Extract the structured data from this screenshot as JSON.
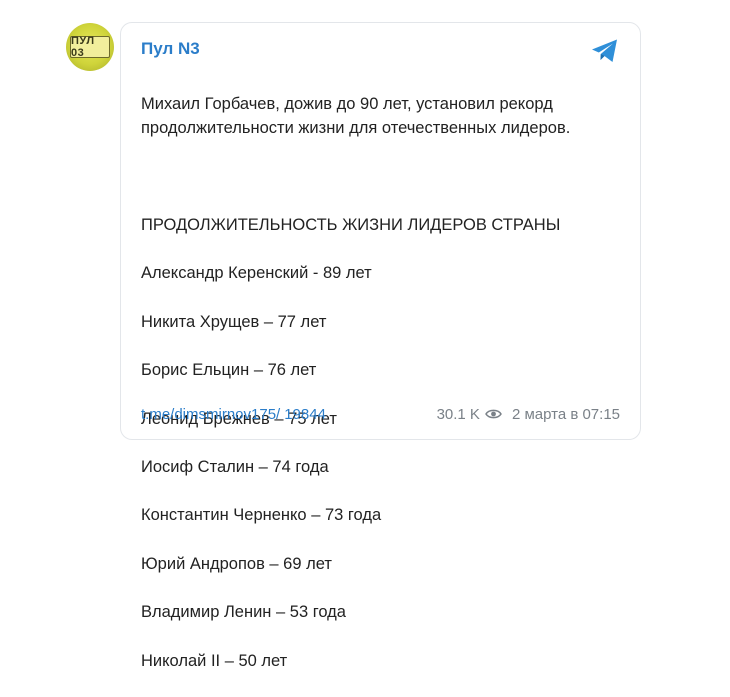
{
  "post": {
    "channel_name": "Пул N3",
    "avatar_text": "ПУЛ 03",
    "lead": "Михаил Горбачев, дожив до 90 лет, установил рекорд продолжительности жизни для отечественных лидеров.",
    "list_title": "ПРОДОЛЖИТЕЛЬНОСТЬ ЖИЗНИ ЛИДЕРОВ СТРАНЫ",
    "items": [
      "Александр Керенский - 89 лет",
      "Никита Хрущев – 77 лет",
      "Борис Ельцин – 76 лет",
      "Леонид Брежнев – 75 лет",
      "Иосиф Сталин – 74 года",
      "Константин Черненко – 73 года",
      "Юрий Андропов – 69 лет",
      "Владимир Ленин – 53 года",
      "Николай II – 50 лет"
    ],
    "link": "t.me/dimsmirnov175/",
    "post_id": "19844",
    "views": "30.1 K",
    "date": "2 марта в 07:15"
  },
  "colors": {
    "link": "#2b7dc9",
    "telegram": "#2f8fd8",
    "text": "#222222",
    "muted": "#7a8188",
    "border": "#e3e6ea"
  },
  "icons": {
    "brand": "telegram-icon",
    "views": "eye-icon"
  }
}
